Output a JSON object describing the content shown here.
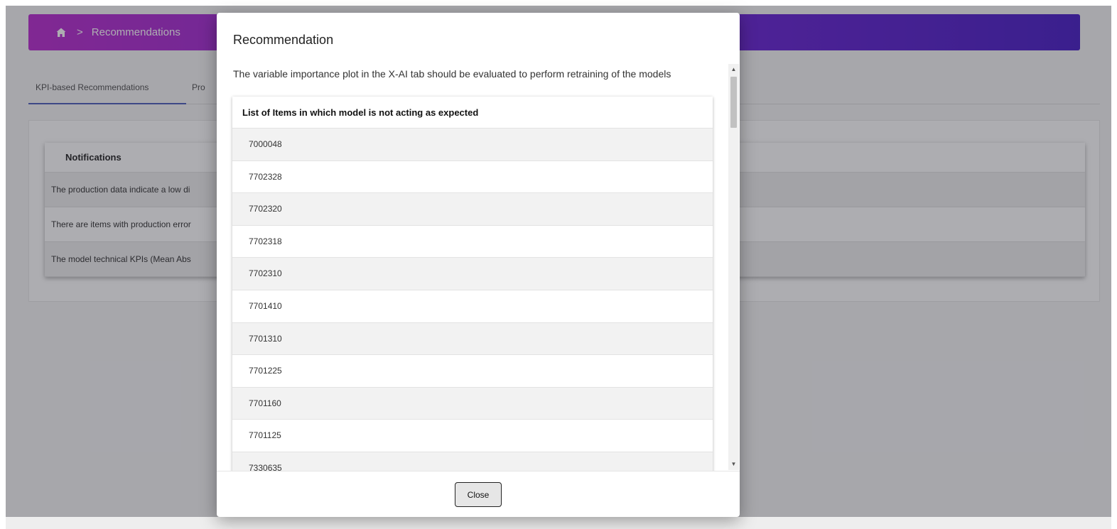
{
  "breadcrumb": {
    "separator": ">",
    "current": "Recommendations"
  },
  "tabs": [
    {
      "label": "KPI-based Recommendations"
    },
    {
      "label": "Pro"
    }
  ],
  "notifications": {
    "title": "Notifications",
    "rows": [
      "The production data indicate a low di",
      "There are items with production error",
      "The model technical KPIs (Mean Abs"
    ]
  },
  "modal": {
    "title": "Recommendation",
    "message": "The variable importance plot in the X-AI tab should be evaluated to perform retraining of the models",
    "list_title": "List of Items in which model is not acting as expected",
    "items": [
      "7000048",
      "7702328",
      "7702320",
      "7702318",
      "7702310",
      "7701410",
      "7701310",
      "7701225",
      "7701160",
      "7701125",
      "7330635"
    ],
    "close_label": "Close"
  },
  "colors": {
    "banner_start": "#b31acb",
    "banner_end": "#3a0cc2",
    "tab_active": "#3f51b5"
  }
}
